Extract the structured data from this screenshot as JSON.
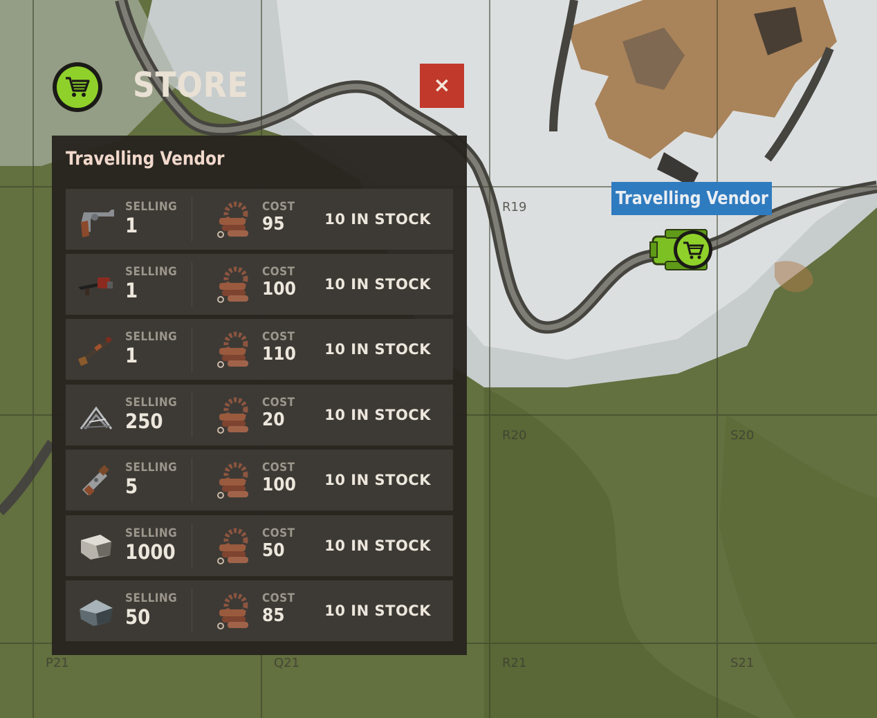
{
  "map": {
    "grid_labels": [
      "R19",
      "R20",
      "S20",
      "P21",
      "Q21",
      "R21",
      "S21"
    ]
  },
  "header": {
    "title": "STORE",
    "icon": "shopping-cart-icon",
    "close_icon": "close-icon",
    "close_symbol": "×",
    "accent_color": "#8fd12a",
    "close_color": "#c0392b"
  },
  "panel": {
    "title": "Travelling Vendor",
    "rows": [
      {
        "item_icon": "revolver-icon",
        "selling_label": "SELLING",
        "selling_qty": "1",
        "cost_icon": "metal-fragments-icon",
        "cost_label": "COST",
        "cost_value": "95",
        "stock": "10 IN STOCK"
      },
      {
        "item_icon": "flamethrower-icon",
        "selling_label": "SELLING",
        "selling_qty": "1",
        "cost_icon": "metal-fragments-icon",
        "cost_label": "COST",
        "cost_value": "100",
        "stock": "10 IN STOCK"
      },
      {
        "item_icon": "rifle-icon",
        "selling_label": "SELLING",
        "selling_qty": "1",
        "cost_icon": "metal-fragments-icon",
        "cost_label": "COST",
        "cost_value": "110",
        "stock": "10 IN STOCK"
      },
      {
        "item_icon": "caltrops-icon",
        "selling_label": "SELLING",
        "selling_qty": "250",
        "cost_icon": "metal-fragments-icon",
        "cost_label": "COST",
        "cost_value": "20",
        "stock": "10 IN STOCK"
      },
      {
        "item_icon": "pipe-shotgun-icon",
        "selling_label": "SELLING",
        "selling_qty": "5",
        "cost_icon": "metal-fragments-icon",
        "cost_label": "COST",
        "cost_value": "100",
        "stock": "10 IN STOCK"
      },
      {
        "item_icon": "stone-icon",
        "selling_label": "SELLING",
        "selling_qty": "1000",
        "cost_icon": "metal-fragments-icon",
        "cost_label": "COST",
        "cost_value": "50",
        "stock": "10 IN STOCK"
      },
      {
        "item_icon": "metal-ore-icon",
        "selling_label": "SELLING",
        "selling_qty": "50",
        "cost_icon": "metal-fragments-icon",
        "cost_label": "COST",
        "cost_value": "85",
        "stock": "10 IN STOCK"
      }
    ]
  },
  "vendor_marker": {
    "label": "Travelling Vendor",
    "icon": "vendor-cart-icon",
    "label_color": "#2f7bbf"
  }
}
